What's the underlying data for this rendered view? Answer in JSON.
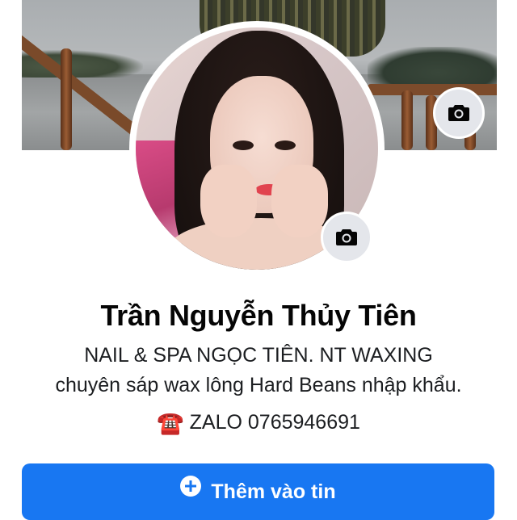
{
  "profile": {
    "name": "Trần Nguyễn Thủy Tiên",
    "bio_line1": "NAIL & SPA NGỌC TIÊN. NT WAXING",
    "bio_line2": "chuyên sáp wax lông Hard Beans nhập khẩu.",
    "bio_line3_icon": "☎️",
    "bio_line3_text": "ZALO 0765946691"
  },
  "cover": {
    "camera_icon": "camera-icon"
  },
  "avatar": {
    "camera_icon": "camera-icon"
  },
  "actions": {
    "add_story_label": "Thêm vào tin",
    "add_story_icon": "plus-circle-icon"
  },
  "colors": {
    "primary": "#1877f2",
    "text": "#050505",
    "icon_button_bg": "#e4e6eb"
  }
}
